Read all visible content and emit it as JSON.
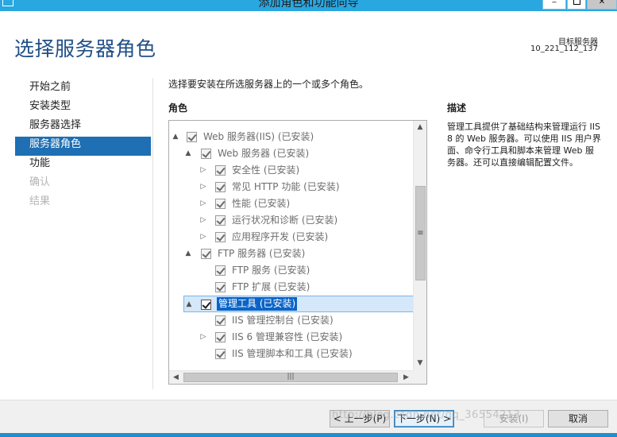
{
  "window": {
    "title": "添加角色和功能向导",
    "minimize_glyph": "_",
    "close_glyph": "✕"
  },
  "header": {
    "page_title": "选择服务器角色",
    "target_label": "目标服务器",
    "target_value": "10_221_112_137"
  },
  "nav": {
    "items": [
      {
        "label": "开始之前",
        "state": "normal"
      },
      {
        "label": "安装类型",
        "state": "normal"
      },
      {
        "label": "服务器选择",
        "state": "normal"
      },
      {
        "label": "服务器角色",
        "state": "active"
      },
      {
        "label": "功能",
        "state": "normal"
      },
      {
        "label": "确认",
        "state": "disabled"
      },
      {
        "label": "结果",
        "state": "disabled"
      }
    ]
  },
  "main": {
    "intro": "选择要安装在所选服务器上的一个或多个角色。",
    "roles_heading": "角色",
    "tree": [
      {
        "label": "Web 服务器(IIS) (已安装)",
        "expander": "▲",
        "checked": true
      },
      {
        "label": "Web 服务器 (已安装)",
        "expander": "▲",
        "checked": true
      },
      {
        "label": "安全性 (已安装)",
        "expander": "▷",
        "checked": true
      },
      {
        "label": "常见 HTTP 功能 (已安装)",
        "expander": "▷",
        "checked": true
      },
      {
        "label": "性能 (已安装)",
        "expander": "▷",
        "checked": true
      },
      {
        "label": "运行状况和诊断 (已安装)",
        "expander": "▷",
        "checked": true
      },
      {
        "label": "应用程序开发 (已安装)",
        "expander": "▷",
        "checked": true
      },
      {
        "label": "FTP 服务器 (已安装)",
        "expander": "▲",
        "checked": true
      },
      {
        "label": "FTP 服务 (已安装)",
        "expander": "",
        "checked": true
      },
      {
        "label": "FTP 扩展 (已安装)",
        "expander": "",
        "checked": true
      },
      {
        "label": "管理工具 (已安装)",
        "expander": "▲",
        "checked": true,
        "selected": true
      },
      {
        "label": "IIS 管理控制台 (已安装)",
        "expander": "",
        "checked": true
      },
      {
        "label": "IIS 6 管理兼容性 (已安装)",
        "expander": "▷",
        "checked": true
      },
      {
        "label": "IIS 管理脚本和工具 (已安装)",
        "expander": "",
        "checked": true
      }
    ],
    "scroll": {
      "up": "▲",
      "down": "▼",
      "left": "◀",
      "right": "▶",
      "v_grip": "≡",
      "h_grip": "|||"
    }
  },
  "description": {
    "heading": "描述",
    "text": "管理工具提供了基础结构来管理运行 IIS 8 的 Web 服务器。可以使用 IIS 用户界面、命令行工具和脚本来管理 Web 服务器。还可以直接编辑配置文件。"
  },
  "footer": {
    "prev_label": "< 上一步(P)",
    "next_label": "下一步(N) >",
    "install_label": "安装(I)",
    "cancel_label": "取消",
    "watermark": "http://blog.csdn.net/qq_36554213"
  }
}
